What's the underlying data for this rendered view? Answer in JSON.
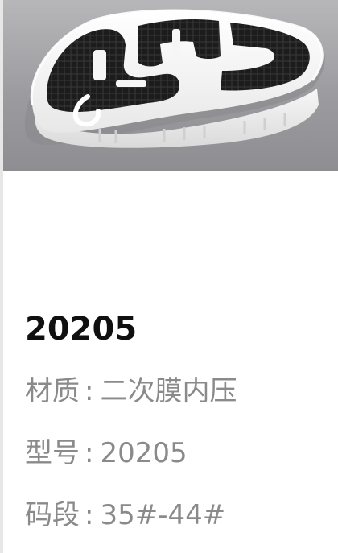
{
  "product": {
    "image_alt": "shoe-sole-photo",
    "model": "20205",
    "specs": [
      {
        "label": "材质",
        "separator": ":",
        "value": "二次膜内压"
      },
      {
        "label": "型号",
        "separator": ":",
        "value": "20205"
      },
      {
        "label": "码段",
        "separator": ":",
        "value": "35#-44#"
      }
    ]
  },
  "colors": {
    "title": "#101010",
    "spec_text": "#8a8a8a",
    "photo_bg": "#9f9fa2",
    "sole_white": "#f4f4f4",
    "sole_black": "#1a1a1a"
  }
}
